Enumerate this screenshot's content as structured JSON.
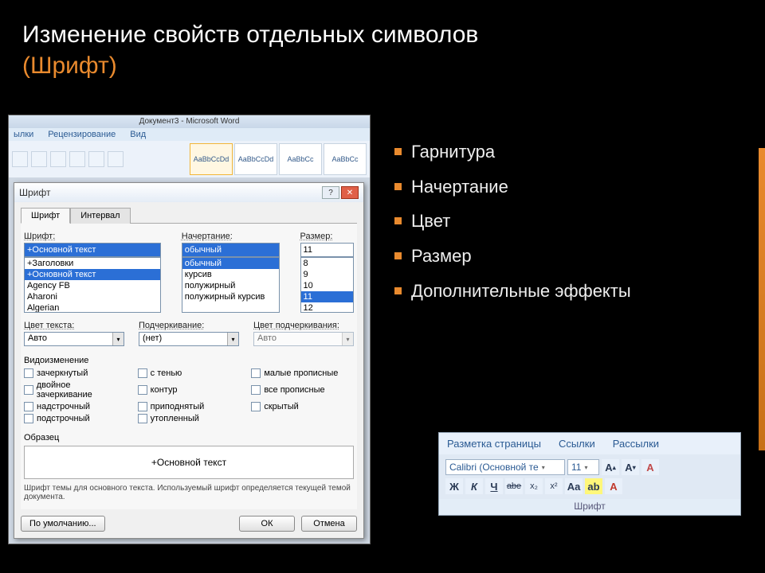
{
  "slide": {
    "title_line1": "Изменение свойств отдельных символов",
    "title_line2": "(Шрифт)"
  },
  "word": {
    "app_title": "Документ3 - Microsoft Word",
    "ribbon_tabs": [
      "ылки",
      "Рецензирование",
      "Вид"
    ],
    "styles": [
      "AaBbCcDd",
      "AaBbCcDd",
      "AaBbCc",
      "AaBbCc"
    ]
  },
  "dialog": {
    "title": "Шрифт",
    "help_icon": "?",
    "close_icon": "✕",
    "tabs": {
      "font": "Шрифт",
      "spacing": "Интервал"
    },
    "labels": {
      "font": "Шрифт:",
      "style": "Начертание:",
      "size": "Размер:",
      "color": "Цвет текста:",
      "underline": "Подчеркивание:",
      "underline_color": "Цвет подчеркивания:",
      "effects": "Видоизменение",
      "preview": "Образец"
    },
    "font_value": "+Основной текст",
    "fonts": [
      "+Заголовки",
      "+Основной текст",
      "Agency FB",
      "Aharoni",
      "Algerian"
    ],
    "style_value": "обычный",
    "styles": [
      "обычный",
      "курсив",
      "полужирный",
      "полужирный курсив"
    ],
    "size_value": "11",
    "sizes": [
      "8",
      "9",
      "10",
      "11",
      "12"
    ],
    "color_value": "Авто",
    "underline_value": "(нет)",
    "underline_color_value": "Авто",
    "effects": {
      "col1": [
        "зачеркнутый",
        "двойное зачеркивание",
        "надстрочный",
        "подстрочный"
      ],
      "col2": [
        "с тенью",
        "контур",
        "приподнятый",
        "утопленный"
      ],
      "col3": [
        "малые прописные",
        "все прописные",
        "скрытый"
      ]
    },
    "preview_text": "+Основной текст",
    "note": "Шрифт темы для основного текста. Используемый шрифт определяется текущей темой документа.",
    "buttons": {
      "default": "По умолчанию...",
      "ok": "ОК",
      "cancel": "Отмена"
    }
  },
  "bullets": [
    "Гарнитура",
    "Начертание",
    "Цвет",
    "Размер",
    "Дополнительные эффекты"
  ],
  "font_ribbon": {
    "tabs": [
      "Разметка страницы",
      "Ссылки",
      "Рассылки"
    ],
    "font_name": "Calibri (Основной те",
    "font_size": "11",
    "row2": [
      "Ж",
      "К",
      "Ч",
      "abe",
      "x₂",
      "x²",
      "Aa"
    ],
    "panel_label": "Шрифт"
  }
}
